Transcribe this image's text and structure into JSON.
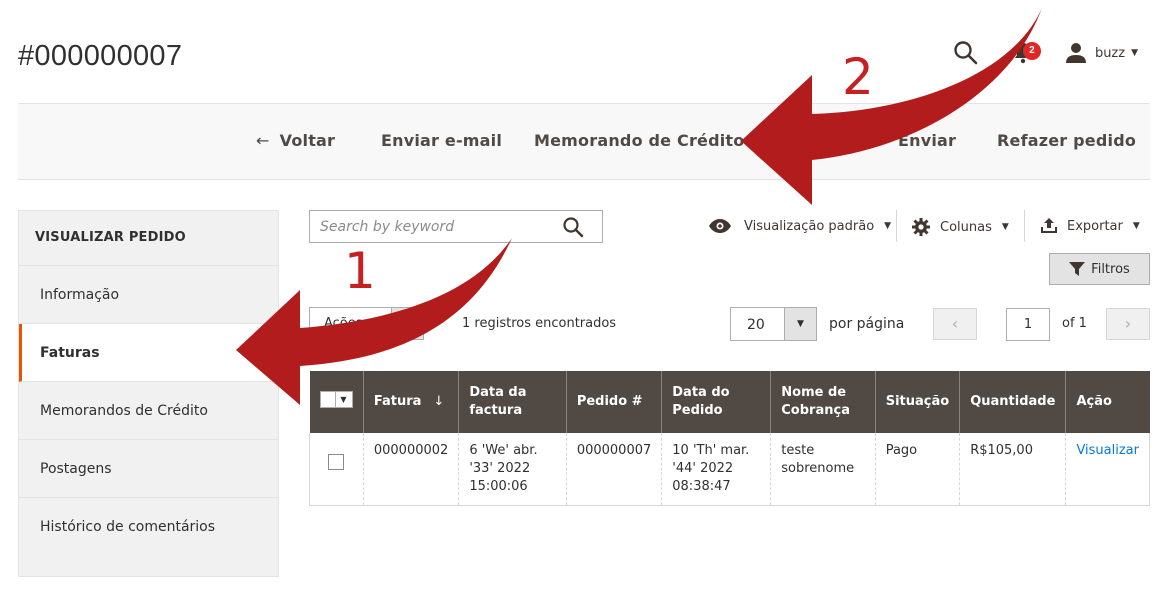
{
  "page": {
    "title": "#000000007"
  },
  "header": {
    "notification_count": "2",
    "user_name": "buzz"
  },
  "actions": {
    "back": "Voltar",
    "send_email": "Enviar e-mail",
    "credit_memo": "Memorando de Crédito",
    "ship": "Enviar",
    "reorder": "Refazer pedido"
  },
  "sidebar": {
    "title": "VISUALIZAR PEDIDO",
    "items": [
      {
        "label": "Informação"
      },
      {
        "label": "Faturas"
      },
      {
        "label": "Memorandos de Crédito"
      },
      {
        "label": "Postagens"
      },
      {
        "label": "Histórico de comentários"
      }
    ]
  },
  "grid": {
    "search_placeholder": "Search by keyword",
    "view_label": "Visualização padrão",
    "columns_label": "Colunas",
    "export_label": "Exportar",
    "filters_label": "Filtros",
    "actions_label": "Ações",
    "records_found": "1 registros encontrados",
    "per_page_value": "20",
    "per_page_label": "por página",
    "page_current": "1",
    "page_total": "of 1",
    "headers": [
      "Fatura",
      "Data da factura",
      "Pedido #",
      "Data do Pedido",
      "Nome de Cobrança",
      "Situação",
      "Quantidade",
      "Ação"
    ],
    "rows": [
      {
        "invoice": "000000002",
        "invoice_date": "6 'We' abr. '33' 2022 15:00:06",
        "order": "000000007",
        "order_date": "10 'Th' mar. '44' 2022 08:38:47",
        "bill_name": "teste sobrenome",
        "status": "Pago",
        "amount": "R$105,00",
        "action": "Visualizar"
      }
    ]
  },
  "annotations": {
    "first": "1",
    "second": "2",
    "arrow_color": "#c72020"
  }
}
